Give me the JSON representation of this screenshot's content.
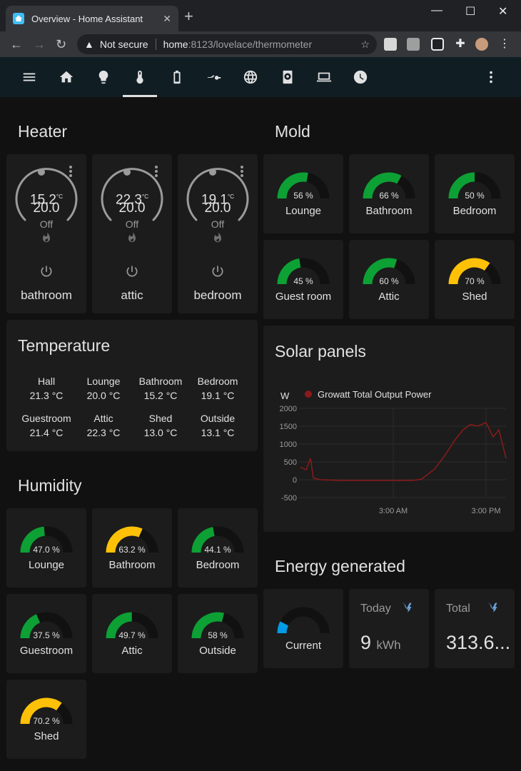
{
  "browser": {
    "tab_title": "Overview - Home Assistant",
    "security": "Not secure",
    "host": "home",
    "path": ":8123/lovelace/thermometer"
  },
  "toolbar": {
    "icons": [
      "menu-icon",
      "home-icon",
      "lightbulb-icon",
      "thermometer-icon",
      "battery-icon",
      "switch-icon",
      "globe-icon",
      "nas-icon",
      "laptop-icon",
      "clock-icon",
      "more-vert-icon"
    ]
  },
  "heater": {
    "title": "Heater",
    "items": [
      {
        "name": "bathroom",
        "current": "15.2",
        "target": "20.0",
        "mode": "Off",
        "unit": "°C"
      },
      {
        "name": "attic",
        "current": "22.3",
        "target": "20.0",
        "mode": "Off",
        "unit": "°C"
      },
      {
        "name": "bedroom",
        "current": "19.1",
        "target": "20.0",
        "mode": "Off",
        "unit": "°C"
      }
    ]
  },
  "temperature": {
    "title": "Temperature",
    "items": [
      {
        "name": "Hall",
        "value": "21.3 °C"
      },
      {
        "name": "Lounge",
        "value": "20.0 °C"
      },
      {
        "name": "Bathroom",
        "value": "15.2 °C"
      },
      {
        "name": "Bedroom",
        "value": "19.1 °C"
      },
      {
        "name": "Guestroom",
        "value": "21.4 °C"
      },
      {
        "name": "Attic",
        "value": "22.3 °C"
      },
      {
        "name": "Shed",
        "value": "13.0 °C"
      },
      {
        "name": "Outside",
        "value": "13.1 °C"
      }
    ]
  },
  "humidity": {
    "title": "Humidity",
    "items": [
      {
        "name": "Lounge",
        "value": "47.0 %",
        "level": 0.47,
        "color": "#0da035"
      },
      {
        "name": "Bathroom",
        "value": "63.2 %",
        "level": 0.632,
        "color": "#ffc107"
      },
      {
        "name": "Bedroom",
        "value": "44.1 %",
        "level": 0.441,
        "color": "#0da035"
      },
      {
        "name": "Guestroom",
        "value": "37.5 %",
        "level": 0.375,
        "color": "#0da035"
      },
      {
        "name": "Attic",
        "value": "49.7 %",
        "level": 0.497,
        "color": "#0da035"
      },
      {
        "name": "Outside",
        "value": "58 %",
        "level": 0.58,
        "color": "#0da035"
      },
      {
        "name": "Shed",
        "value": "70.2 %",
        "level": 0.702,
        "color": "#ffc107"
      }
    ]
  },
  "mold": {
    "title": "Mold",
    "items": [
      {
        "name": "Lounge",
        "value": "56 %",
        "level": 0.56,
        "color": "#0da035"
      },
      {
        "name": "Bathroom",
        "value": "66 %",
        "level": 0.66,
        "color": "#0da035"
      },
      {
        "name": "Bedroom",
        "value": "50 %",
        "level": 0.5,
        "color": "#0da035"
      },
      {
        "name": "Guest room",
        "value": "45 %",
        "level": 0.45,
        "color": "#0da035"
      },
      {
        "name": "Attic",
        "value": "60 %",
        "level": 0.6,
        "color": "#0da035"
      },
      {
        "name": "Shed",
        "value": "70 %",
        "level": 0.7,
        "color": "#ffc107"
      }
    ]
  },
  "solar": {
    "title": "Solar panels"
  },
  "chart_data": {
    "type": "line",
    "title": "",
    "ylabel": "W",
    "xlabel": "",
    "ylim": [
      -500,
      2000
    ],
    "yticks": [
      "2000",
      "1500",
      "1000",
      "500",
      "0",
      "-500"
    ],
    "xticks": [
      "3:00 AM",
      "3:00 PM"
    ],
    "grid": true,
    "legend": "top",
    "series": [
      {
        "name": "Growatt Total Output Power",
        "color": "#8b1a1a",
        "x": [
          "5:00 PM",
          "6:00 PM",
          "7:00 PM",
          "8:00 PM",
          "9:00 PM",
          "11:00 PM",
          "3:00 AM",
          "6:00 AM",
          "7:00 AM",
          "8:00 AM",
          "9:00 AM",
          "10:00 AM",
          "11:00 AM",
          "12:00 PM",
          "1:00 PM",
          "2:00 PM",
          "3:00 PM",
          "3:30 PM",
          "4:00 PM"
        ],
        "values": [
          350,
          280,
          600,
          50,
          0,
          -20,
          -20,
          -20,
          20,
          300,
          700,
          1100,
          1400,
          1550,
          1500,
          1600,
          1200,
          1400,
          600
        ]
      }
    ]
  },
  "energy": {
    "title": "Energy generated",
    "current_label": "Current",
    "current_level": 0.15,
    "current_color": "#039be5",
    "today_label": "Today",
    "today_value": "9",
    "today_unit": "kWh",
    "total_label": "Total",
    "total_value": "313.6..."
  }
}
